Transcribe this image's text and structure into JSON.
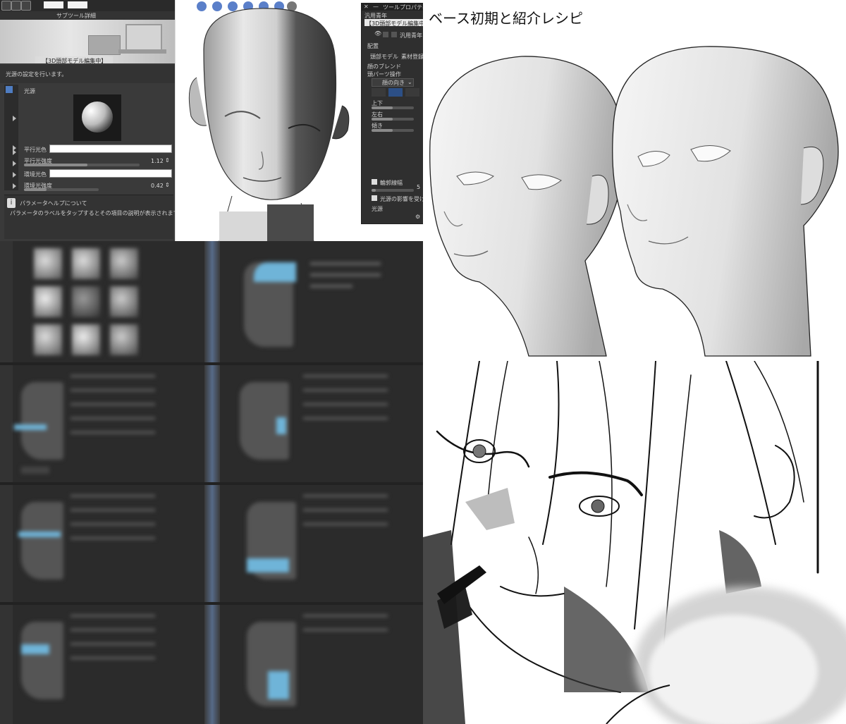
{
  "top_left_panel": {
    "header_title": "サブツール詳細",
    "mode_banner": "【3D頭部モデル編集中】",
    "description": "光源の設定を行います。",
    "section_label": "光源",
    "params": [
      {
        "label": "平行光色"
      },
      {
        "label": "平行光強度",
        "value": "1.12",
        "fill": 0.55
      },
      {
        "label": "環境光色"
      },
      {
        "label": "環境光強度",
        "value": "0.42",
        "fill": 0.3
      }
    ],
    "help_title": "パラメータヘルプについて",
    "help_text": "パラメータのラベルをタップするとその項目の説明が表示されます。"
  },
  "tool_property": {
    "title": "ツールプロパティ",
    "preset": "汎用青年",
    "mode_banner": "【3D頭部モデル編集中】",
    "visibility_label": "汎用青年",
    "arrangement": "配置",
    "head_model_label": "頭部モデル",
    "material_register": "素材登録",
    "face_blend": "顔のブレンド",
    "head_parts_op": "頭パーツ操作",
    "face_direction": "顔の向き",
    "sliders": [
      {
        "label": "上下",
        "fill": 0.5
      },
      {
        "label": "左右",
        "fill": 0.5
      },
      {
        "label": "傾き",
        "fill": 0.5
      }
    ],
    "outline_width": "輪郭線幅",
    "outline_value": "5",
    "light_influence": "光源の影響を受ける",
    "light_source": "光源"
  },
  "right_title": "ベース初期と紹介レシピ",
  "colors": {
    "panel_dark": "#3a3a3a",
    "panel_darker": "#2f2f2f",
    "accent_blue": "#6fb4d8"
  }
}
